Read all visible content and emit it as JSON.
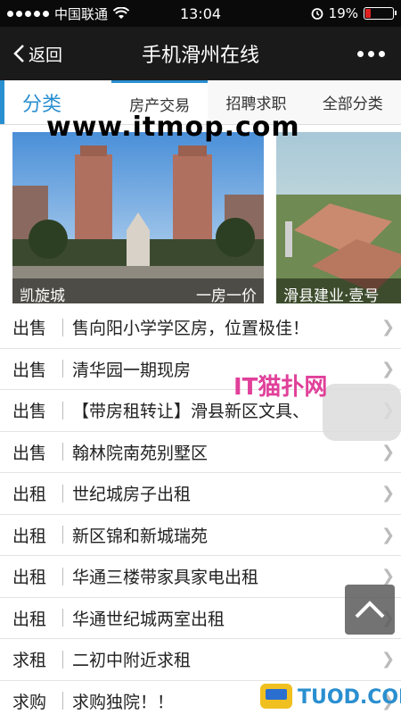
{
  "status": {
    "carrier": "中国联通",
    "time": "13:04",
    "battery_pct": "19%",
    "battery_level": 0.19
  },
  "nav": {
    "back_label": "返回",
    "title": "手机滑州在线"
  },
  "tabs": {
    "category_label": "分类",
    "items": [
      "房产交易",
      "招聘求职",
      "全部分类"
    ]
  },
  "watermark": "www.itmop.com",
  "carousel": [
    {
      "left": "凯旋城",
      "right": "一房一价"
    },
    {
      "left": "滑县建业·壹号",
      "right": ""
    }
  ],
  "listings": [
    {
      "type": "出售",
      "title": "售向阳小学学区房，位置极佳！"
    },
    {
      "type": "出售",
      "title": "清华园一期现房"
    },
    {
      "type": "出售",
      "title": "【带房租转让】滑县新区文具、"
    },
    {
      "type": "出售",
      "title": "翰林院南苑别墅区"
    },
    {
      "type": "出租",
      "title": "世纪城房子出租"
    },
    {
      "type": "出租",
      "title": "新区锦和新城瑞苑"
    },
    {
      "type": "出租",
      "title": "华通三楼带家具家电出租"
    },
    {
      "type": "出租",
      "title": "华通世纪城两室出租"
    },
    {
      "type": "求租",
      "title": "二初中附近求租"
    },
    {
      "type": "求购",
      "title": "求购独院！！"
    }
  ],
  "it_watermark": "IT猫扑网",
  "logo_watermark": "TUOD.COM"
}
